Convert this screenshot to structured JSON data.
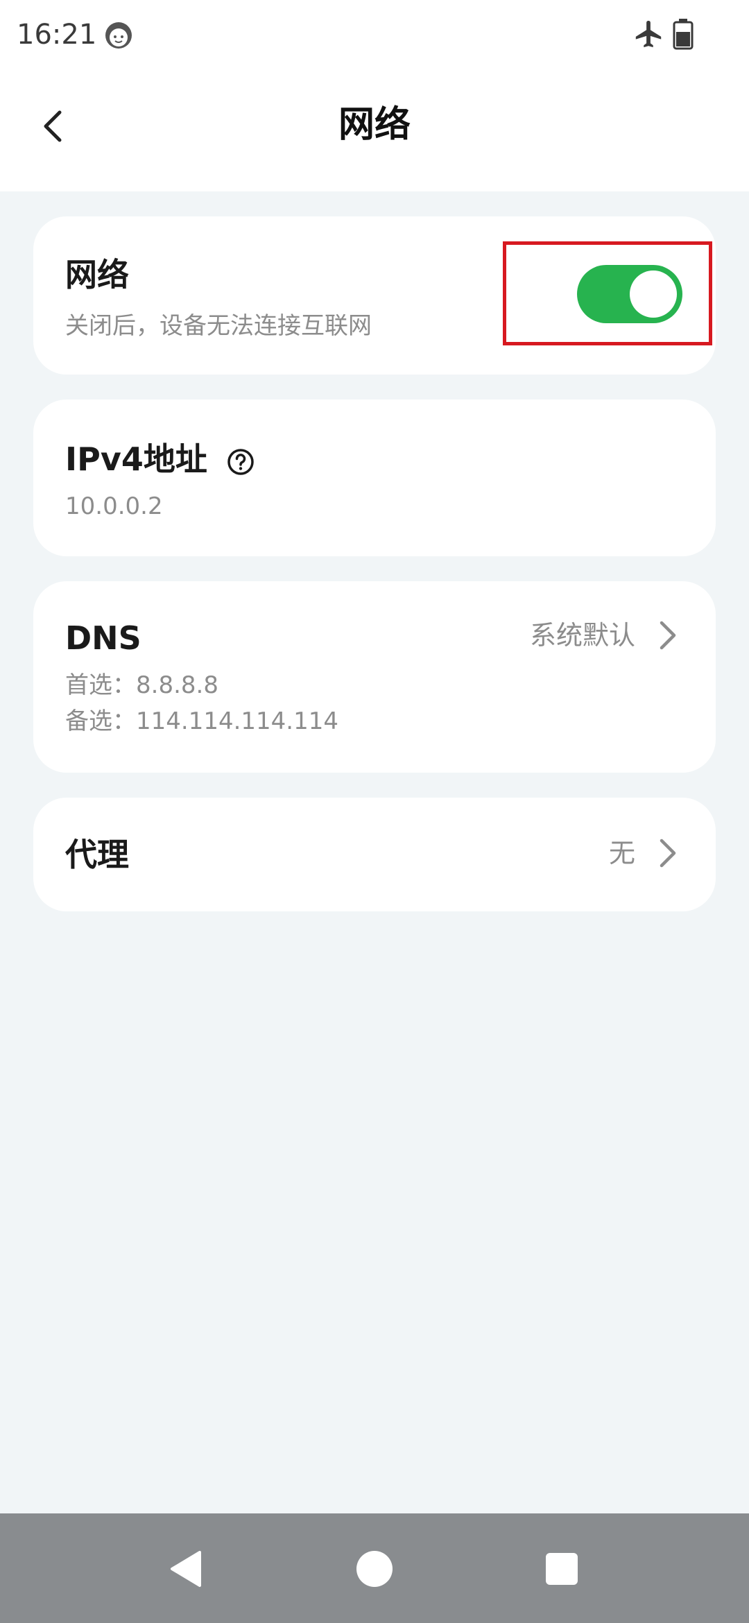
{
  "status_bar": {
    "time": "16:21"
  },
  "header": {
    "title": "网络",
    "back_icon": "chevron-left-icon"
  },
  "network_card": {
    "title": "网络",
    "subtitle": "关闭后，设备无法连接互联网",
    "toggle_on": true
  },
  "ipv4_card": {
    "title": "IPv4地址",
    "value": "10.0.0.2"
  },
  "dns_card": {
    "title": "DNS",
    "mode": "系统默认",
    "primary": "首选：8.8.8.8",
    "secondary": "备选：114.114.114.114"
  },
  "proxy_card": {
    "title": "代理",
    "value": "无"
  },
  "colors": {
    "accent_green": "#27b34f",
    "highlight_red": "#d71920",
    "background": "#f1f5f7",
    "nav_bar": "#898c8f"
  }
}
